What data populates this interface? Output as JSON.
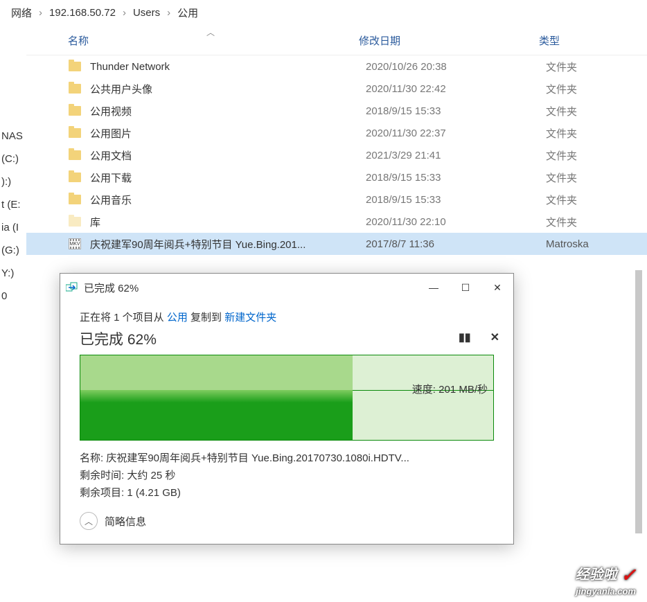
{
  "breadcrumb": [
    "网络",
    "192.168.50.72",
    "Users",
    "公用"
  ],
  "columns": {
    "name": "名称",
    "date": "修改日期",
    "type": "类型"
  },
  "folder_type": "文件夹",
  "files": [
    {
      "icon": "folder",
      "name": "Thunder Network",
      "date": "2020/10/26 20:38",
      "type": "文件夹",
      "sel": false
    },
    {
      "icon": "folder",
      "name": "公共用户头像",
      "date": "2020/11/30 22:42",
      "type": "文件夹",
      "sel": false
    },
    {
      "icon": "folder",
      "name": "公用视频",
      "date": "2018/9/15 15:33",
      "type": "文件夹",
      "sel": false
    },
    {
      "icon": "folder",
      "name": "公用图片",
      "date": "2020/11/30 22:37",
      "type": "文件夹",
      "sel": false
    },
    {
      "icon": "folder",
      "name": "公用文档",
      "date": "2021/3/29 21:41",
      "type": "文件夹",
      "sel": false
    },
    {
      "icon": "folder",
      "name": "公用下载",
      "date": "2018/9/15 15:33",
      "type": "文件夹",
      "sel": false
    },
    {
      "icon": "folder",
      "name": "公用音乐",
      "date": "2018/9/15 15:33",
      "type": "文件夹",
      "sel": false
    },
    {
      "icon": "folder-faded",
      "name": "库",
      "date": "2020/11/30 22:10",
      "type": "文件夹",
      "sel": false
    },
    {
      "icon": "mkv",
      "name": "庆祝建军90周年阅兵+特别节目 Yue.Bing.201...",
      "date": "2017/8/7 11:36",
      "type": "Matroska",
      "sel": true
    }
  ],
  "sidebar": [
    "NAS",
    "(C:)",
    "):)",
    "t (E:",
    "ia (I",
    "(G:)",
    "Y:)",
    "0"
  ],
  "dialog": {
    "title": "已完成 62%",
    "copy_prefix": "正在将 1 个项目从 ",
    "copy_from": "公用",
    "copy_mid": " 复制到 ",
    "copy_to": "新建文件夹",
    "progress_text": "已完成 62%",
    "speed_label": "速度: 201 MB/秒",
    "name_label": "名称:",
    "name_value": "庆祝建军90周年阅兵+特别节目 Yue.Bing.20170730.1080i.HDTV...",
    "time_label": "剩余时间:",
    "time_value": "大约 25 秒",
    "items_label": "剩余项目:",
    "items_value": "1 (4.21 GB)",
    "more_info": "简略信息",
    "progress_percent": 62
  },
  "watermark": {
    "line1": "经验啦",
    "line2": "jingyanla.com"
  }
}
